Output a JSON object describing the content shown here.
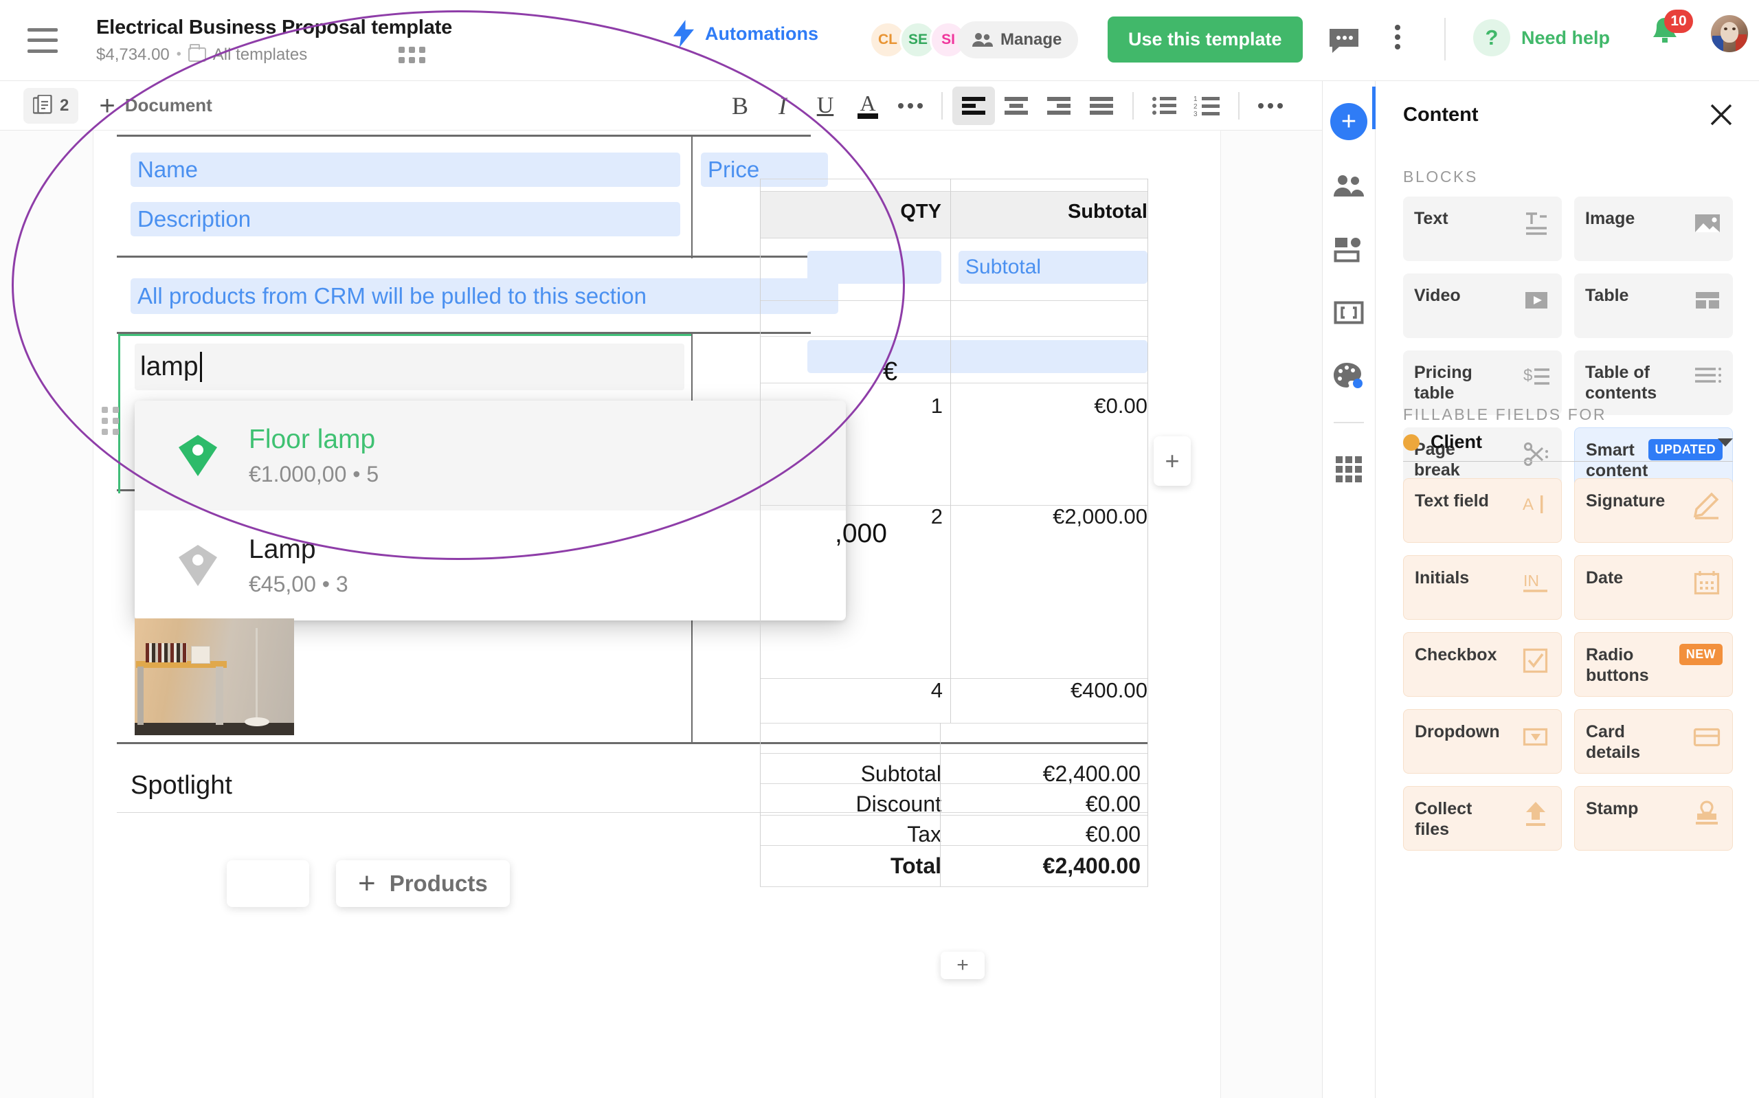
{
  "header": {
    "menu_icon": "hamburger-icon",
    "title": "Electrical Business Proposal template",
    "price": "$4,734.00",
    "separator_dot": "•",
    "folder_icon": "folder-icon",
    "breadcrumb_folder": "All templates",
    "automations_label": "Automations",
    "automations_icon": "lightning-bolt-icon",
    "avatars": [
      {
        "initials": "CL",
        "color": "#e89433",
        "bg": "#fdeedd"
      },
      {
        "initials": "SE",
        "color": "#32a85c",
        "bg": "#e2f5e8"
      },
      {
        "initials": "SI",
        "color": "#f0359c",
        "bg": "#fde9f6"
      }
    ],
    "manage_label": "Manage",
    "manage_icon": "people-icon",
    "use_template_label": "Use this template",
    "chat_icon": "chat-bubble-icon",
    "more_icon": "vertical-kebab-icon",
    "need_help_label": "Need help",
    "need_help_icon": "question-mark-icon",
    "notification_icon": "bell-icon",
    "notification_count": "10",
    "avatar_icon": "user-avatar"
  },
  "toolbar": {
    "page_count": "2",
    "pages_icon": "pages-icon",
    "add_document_label": "Document",
    "add_icon": "plus-icon",
    "format_buttons": [
      {
        "name": "bold",
        "glyph": "B"
      },
      {
        "name": "italic",
        "glyph": "I"
      },
      {
        "name": "underline",
        "glyph": "U"
      },
      {
        "name": "text-color",
        "glyph": "A"
      },
      {
        "name": "more-text-options",
        "glyph": "•••"
      }
    ],
    "align_buttons": [
      "align-left",
      "align-center",
      "align-right",
      "align-justify"
    ],
    "list_buttons": [
      "bulleted-list",
      "numbered-list"
    ],
    "overflow_button": "more-options"
  },
  "document": {
    "fields": {
      "name": "Name",
      "description": "Description",
      "price": "Price",
      "crm_note": "All products from CRM will be pulled to this section",
      "subtotal_field": "Subtotal"
    },
    "search_value": "lamp",
    "spotlight_label": "Spotlight",
    "add_products_label": "Products",
    "add_products_icon": "plus-icon",
    "side_add_icon": "plus-icon",
    "bottom_add_icon": "plus-icon",
    "drag_handle_icon": "drag-dots-icon",
    "product_image_alt": "floor-lamp-photo"
  },
  "autocomplete": {
    "results": [
      {
        "name": "Floor lamp",
        "meta": "€1.000,00 • 5",
        "highlighted": true,
        "icon": "tag-icon",
        "icon_color": "#2dbb6a"
      },
      {
        "name": "Lamp",
        "meta": "€45,00 • 3",
        "highlighted": false,
        "icon": "tag-icon",
        "icon_color": "#c4c4c4"
      }
    ]
  },
  "pricing_table": {
    "headers": {
      "qty": "QTY",
      "subtotal": "Subtotal"
    },
    "rows": [
      {
        "qty": "1",
        "subtotal": "€0.00"
      },
      {
        "qty": "2",
        "subtotal": "€2,000.00"
      },
      {
        "qty": "4",
        "subtotal": "€400.00"
      }
    ],
    "stray_euro": "€",
    "stray_amount": ",000",
    "totals": [
      {
        "label": "Subtotal",
        "value": "€2,400.00",
        "bold": false
      },
      {
        "label": "Discount",
        "value": "€0.00",
        "bold": false
      },
      {
        "label": "Tax",
        "value": "€0.00",
        "bold": false
      },
      {
        "label": "Total",
        "value": "€2,400.00",
        "bold": true
      }
    ]
  },
  "rail": {
    "items": [
      {
        "name": "add-block",
        "icon": "plus-circle-icon",
        "active": true
      },
      {
        "name": "recipients",
        "icon": "people-icon"
      },
      {
        "name": "layout",
        "icon": "layout-icon"
      },
      {
        "name": "variables",
        "icon": "variables-icon"
      },
      {
        "name": "theme",
        "icon": "palette-icon",
        "badge": true
      },
      {
        "name": "apps",
        "icon": "grid-icon"
      }
    ]
  },
  "panel": {
    "title": "Content",
    "close_icon": "close-icon",
    "blocks_label": "BLOCKS",
    "blocks": [
      {
        "label": "Text",
        "icon": "text-icon",
        "style": "grey"
      },
      {
        "label": "Image",
        "icon": "image-icon",
        "style": "grey"
      },
      {
        "label": "Video",
        "icon": "video-icon",
        "style": "grey"
      },
      {
        "label": "Table",
        "icon": "table-icon",
        "style": "grey"
      },
      {
        "label": "Pricing table",
        "icon": "pricing-table-icon",
        "style": "grey"
      },
      {
        "label": "Table of contents",
        "icon": "toc-icon",
        "style": "grey"
      },
      {
        "label": "Page break",
        "icon": "scissors-icon",
        "style": "grey"
      },
      {
        "label": "Smart content",
        "icon": "smart-content-icon",
        "style": "blue",
        "badge": "UPDATED",
        "badge_style": "updated"
      }
    ],
    "fillable_label": "FILLABLE FIELDS FOR",
    "role_dot_color": "#eda73c",
    "role_name": "Client",
    "role_caret_icon": "chevron-down-icon",
    "fields": [
      {
        "label": "Text field",
        "icon": "text-field-icon"
      },
      {
        "label": "Signature",
        "icon": "signature-icon"
      },
      {
        "label": "Initials",
        "icon": "initials-icon"
      },
      {
        "label": "Date",
        "icon": "calendar-icon"
      },
      {
        "label": "Checkbox",
        "icon": "checkbox-icon"
      },
      {
        "label": "Radio buttons",
        "icon": "radio-icon",
        "badge": "NEW",
        "badge_style": "new"
      },
      {
        "label": "Dropdown",
        "icon": "dropdown-icon"
      },
      {
        "label": "Card details",
        "icon": "card-icon"
      },
      {
        "label": "Collect files",
        "icon": "upload-icon"
      },
      {
        "label": "Stamp",
        "icon": "stamp-icon"
      }
    ]
  },
  "colors": {
    "brand_green": "#41b86a",
    "brand_blue": "#2f7cf6",
    "badge_red": "#e8403a",
    "badge_orange": "#f2903c",
    "field_blue": "#e0ebfd",
    "magnifier_purple": "#8e3da8"
  }
}
